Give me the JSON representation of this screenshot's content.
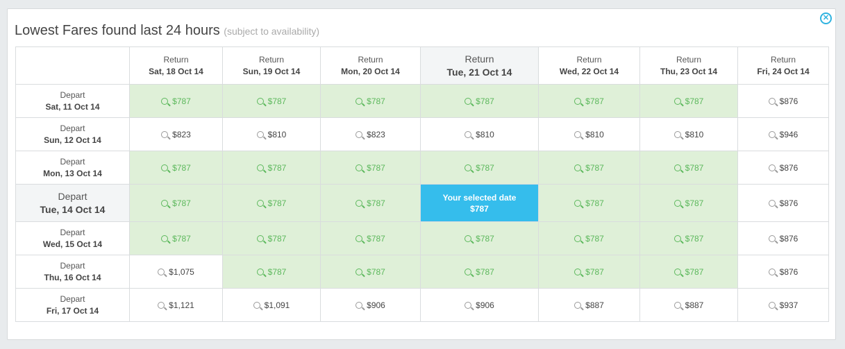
{
  "title": "Lowest Fares found last 24 hours",
  "subtitle": "(subject to availability)",
  "close_icon": "close-circle-icon",
  "colors": {
    "low_fare_bg": "#dff0d8",
    "low_fare_text": "#5cb85c",
    "selected_bg": "#35bdec",
    "accent": "#2fb3e0"
  },
  "return_label": "Return",
  "depart_label": "Depart",
  "selected_label": "Your selected date",
  "return_dates": [
    "Sat, 18 Oct 14",
    "Sun, 19 Oct 14",
    "Mon, 20 Oct 14",
    "Tue, 21 Oct 14",
    "Wed, 22 Oct 14",
    "Thu, 23 Oct 14",
    "Fri, 24 Oct 14"
  ],
  "selected_return_index": 3,
  "selected_depart_index": 3,
  "rows": [
    {
      "depart": "Sat, 11 Oct 14",
      "fares": [
        {
          "price": "$787",
          "low": true
        },
        {
          "price": "$787",
          "low": true
        },
        {
          "price": "$787",
          "low": true
        },
        {
          "price": "$787",
          "low": true
        },
        {
          "price": "$787",
          "low": true
        },
        {
          "price": "$787",
          "low": true
        },
        {
          "price": "$876",
          "low": false
        }
      ]
    },
    {
      "depart": "Sun, 12 Oct 14",
      "fares": [
        {
          "price": "$823",
          "low": false
        },
        {
          "price": "$810",
          "low": false
        },
        {
          "price": "$823",
          "low": false
        },
        {
          "price": "$810",
          "low": false
        },
        {
          "price": "$810",
          "low": false
        },
        {
          "price": "$810",
          "low": false
        },
        {
          "price": "$946",
          "low": false
        }
      ]
    },
    {
      "depart": "Mon, 13 Oct 14",
      "fares": [
        {
          "price": "$787",
          "low": true
        },
        {
          "price": "$787",
          "low": true
        },
        {
          "price": "$787",
          "low": true
        },
        {
          "price": "$787",
          "low": true
        },
        {
          "price": "$787",
          "low": true
        },
        {
          "price": "$787",
          "low": true
        },
        {
          "price": "$876",
          "low": false
        }
      ]
    },
    {
      "depart": "Tue, 14 Oct 14",
      "fares": [
        {
          "price": "$787",
          "low": true
        },
        {
          "price": "$787",
          "low": true
        },
        {
          "price": "$787",
          "low": true
        },
        {
          "price": "$787",
          "low": true,
          "selected": true
        },
        {
          "price": "$787",
          "low": true
        },
        {
          "price": "$787",
          "low": true
        },
        {
          "price": "$876",
          "low": false
        }
      ]
    },
    {
      "depart": "Wed, 15 Oct 14",
      "fares": [
        {
          "price": "$787",
          "low": true
        },
        {
          "price": "$787",
          "low": true
        },
        {
          "price": "$787",
          "low": true
        },
        {
          "price": "$787",
          "low": true
        },
        {
          "price": "$787",
          "low": true
        },
        {
          "price": "$787",
          "low": true
        },
        {
          "price": "$876",
          "low": false
        }
      ]
    },
    {
      "depart": "Thu, 16 Oct 14",
      "fares": [
        {
          "price": "$1,075",
          "low": false
        },
        {
          "price": "$787",
          "low": true
        },
        {
          "price": "$787",
          "low": true
        },
        {
          "price": "$787",
          "low": true
        },
        {
          "price": "$787",
          "low": true
        },
        {
          "price": "$787",
          "low": true
        },
        {
          "price": "$876",
          "low": false
        }
      ]
    },
    {
      "depart": "Fri, 17 Oct 14",
      "fares": [
        {
          "price": "$1,121",
          "low": false
        },
        {
          "price": "$1,091",
          "low": false
        },
        {
          "price": "$906",
          "low": false
        },
        {
          "price": "$906",
          "low": false
        },
        {
          "price": "$887",
          "low": false
        },
        {
          "price": "$887",
          "low": false
        },
        {
          "price": "$937",
          "low": false
        }
      ]
    }
  ]
}
